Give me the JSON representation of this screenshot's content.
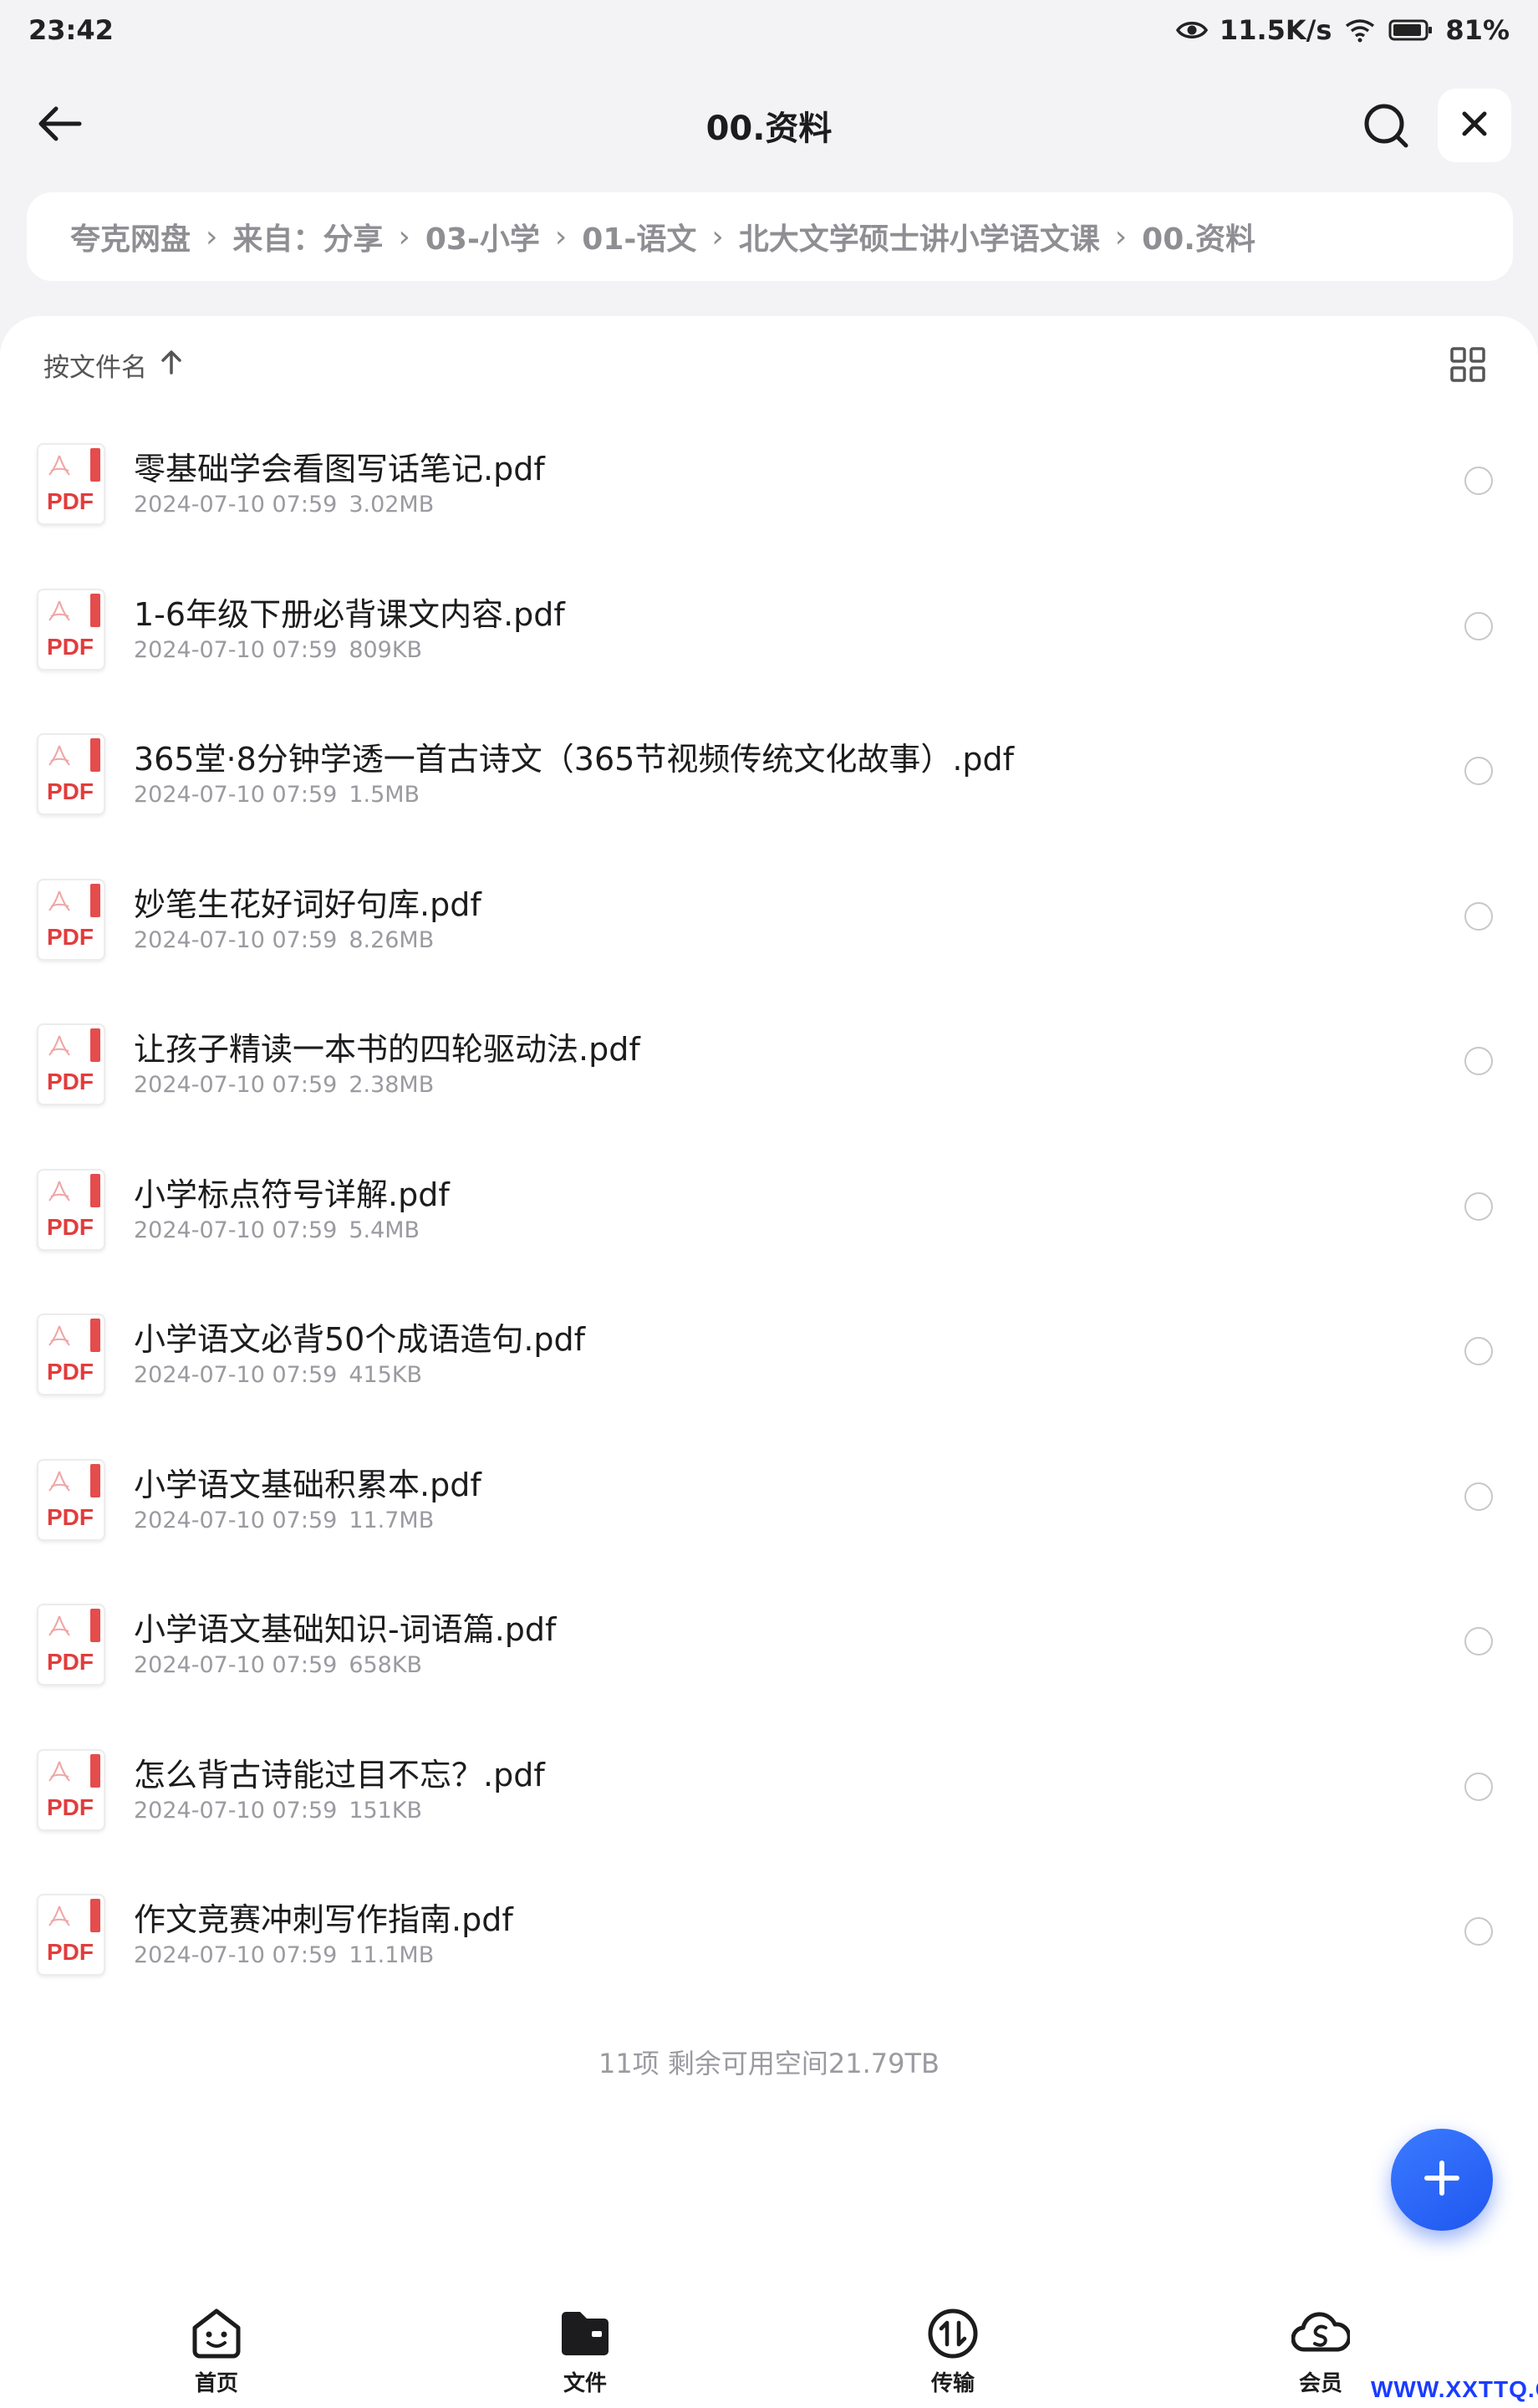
{
  "status_bar": {
    "time": "23:42",
    "network_speed": "11.5K/s",
    "battery": "81%"
  },
  "header": {
    "title": "00.资料"
  },
  "breadcrumb": [
    "夸克网盘",
    "来自：分享",
    "03-小学",
    "01-语文",
    "北大文学硕士讲小学语文课",
    "00.资料"
  ],
  "sort": {
    "label": "按文件名"
  },
  "files": [
    {
      "name": "零基础学会看图写话笔记.pdf",
      "date": "2024-07-10 07:59",
      "size": "3.02MB"
    },
    {
      "name": "1-6年级下册必背课文内容.pdf",
      "date": "2024-07-10 07:59",
      "size": "809KB"
    },
    {
      "name": "365堂·8分钟学透一首古诗文（365节视频传统文化故事）.pdf",
      "date": "2024-07-10 07:59",
      "size": "1.5MB"
    },
    {
      "name": "妙笔生花好词好句库.pdf",
      "date": "2024-07-10 07:59",
      "size": "8.26MB"
    },
    {
      "name": "让孩子精读一本书的四轮驱动法.pdf",
      "date": "2024-07-10 07:59",
      "size": "2.38MB"
    },
    {
      "name": "小学标点符号详解.pdf",
      "date": "2024-07-10 07:59",
      "size": "5.4MB"
    },
    {
      "name": "小学语文必背50个成语造句.pdf",
      "date": "2024-07-10 07:59",
      "size": "415KB"
    },
    {
      "name": "小学语文基础积累本.pdf",
      "date": "2024-07-10 07:59",
      "size": "11.7MB"
    },
    {
      "name": "小学语文基础知识-词语篇.pdf",
      "date": "2024-07-10 07:59",
      "size": "658KB"
    },
    {
      "name": "怎么背古诗能过目不忘？.pdf",
      "date": "2024-07-10 07:59",
      "size": "151KB"
    },
    {
      "name": "作文竞赛冲刺写作指南.pdf",
      "date": "2024-07-10 07:59",
      "size": "11.1MB"
    }
  ],
  "file_icon_label": "PDF",
  "summary": "11项 剩余可用空间21.79TB",
  "bottom_nav": [
    {
      "label": "首页",
      "icon": "home-face-icon"
    },
    {
      "label": "文件",
      "icon": "folder-icon"
    },
    {
      "label": "传输",
      "icon": "transfer-icon"
    },
    {
      "label": "会员",
      "icon": "member-cloud-icon"
    }
  ],
  "watermark": "WWW.XXTTQ.COM",
  "colors": {
    "accent": "#1f56f0",
    "pdf_red": "#e23c3c",
    "background": "#f3f3f5"
  }
}
